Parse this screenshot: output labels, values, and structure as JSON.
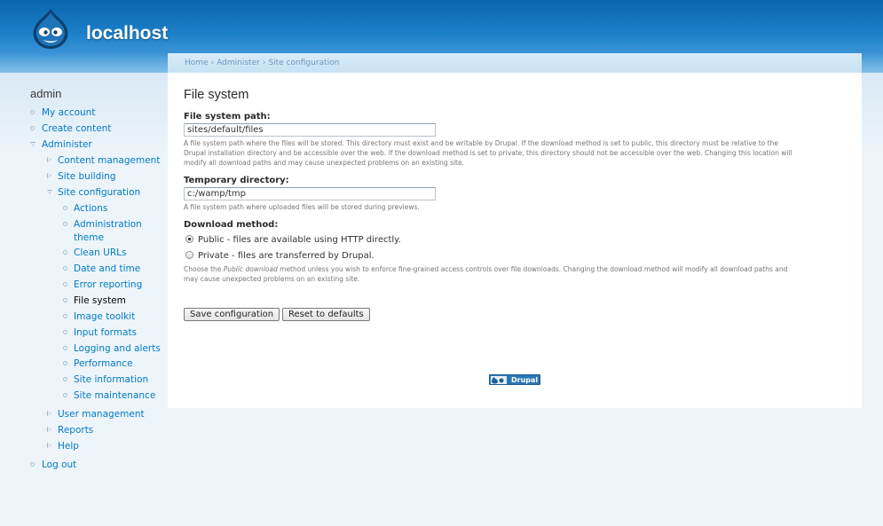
{
  "site": {
    "name": "localhost"
  },
  "breadcrumb": [
    "Home",
    "Administer",
    "Site configuration"
  ],
  "sidebar": {
    "title": "admin",
    "items": {
      "my_account": "My account",
      "create_content": "Create content",
      "administer": "Administer",
      "content_management": "Content management",
      "site_building": "Site building",
      "site_configuration": "Site configuration",
      "actions": "Actions",
      "administration_theme_1": "Administration",
      "administration_theme_2": "theme",
      "clean_urls": "Clean URLs",
      "date_time": "Date and time",
      "error_reporting": "Error reporting",
      "file_system": "File system",
      "image_toolkit": "Image toolkit",
      "input_formats": "Input formats",
      "logging_alerts": "Logging and alerts",
      "performance": "Performance",
      "site_information": "Site information",
      "site_maintenance": "Site maintenance",
      "user_management": "User management",
      "reports": "Reports",
      "help": "Help",
      "log_out": "Log out"
    }
  },
  "page": {
    "title": "File system",
    "file_system_path": {
      "label": "File system path:",
      "value": "sites/default/files",
      "desc_1": "A file system path where the files will be stored. This directory must exist and be writable by Drupal. If the download method is set to public, this directory must be relative to the",
      "desc_2": "Drupal installation directory and be accessible over the web. If the download method is set to private, this directory should not be accessible over the web. Changing this location will",
      "desc_3": "modify all download paths and may cause unexpected problems on an existing site."
    },
    "temporary_directory": {
      "label": "Temporary directory:",
      "value": "c:/wamp/tmp",
      "desc": "A file system path where uploaded files will be stored during previews."
    },
    "download_method": {
      "label": "Download method:",
      "option_public": "Public - files are available using HTTP directly.",
      "option_private": "Private - files are transferred by Drupal.",
      "selected": "public",
      "desc_pre": "Choose the ",
      "desc_em": "Public download",
      "desc_post": " method unless you wish to enforce fine-grained access controls over file downloads. Changing the download method will modify all download paths and",
      "desc_2": "may cause unexpected problems on an existing site."
    },
    "buttons": {
      "save": "Save configuration",
      "reset": "Reset to defaults"
    }
  },
  "footer": {
    "powered_by": "Drupal"
  },
  "colors": {
    "link": "#027ac6",
    "header": "#1b7fc8",
    "background": "#edf5fa"
  }
}
